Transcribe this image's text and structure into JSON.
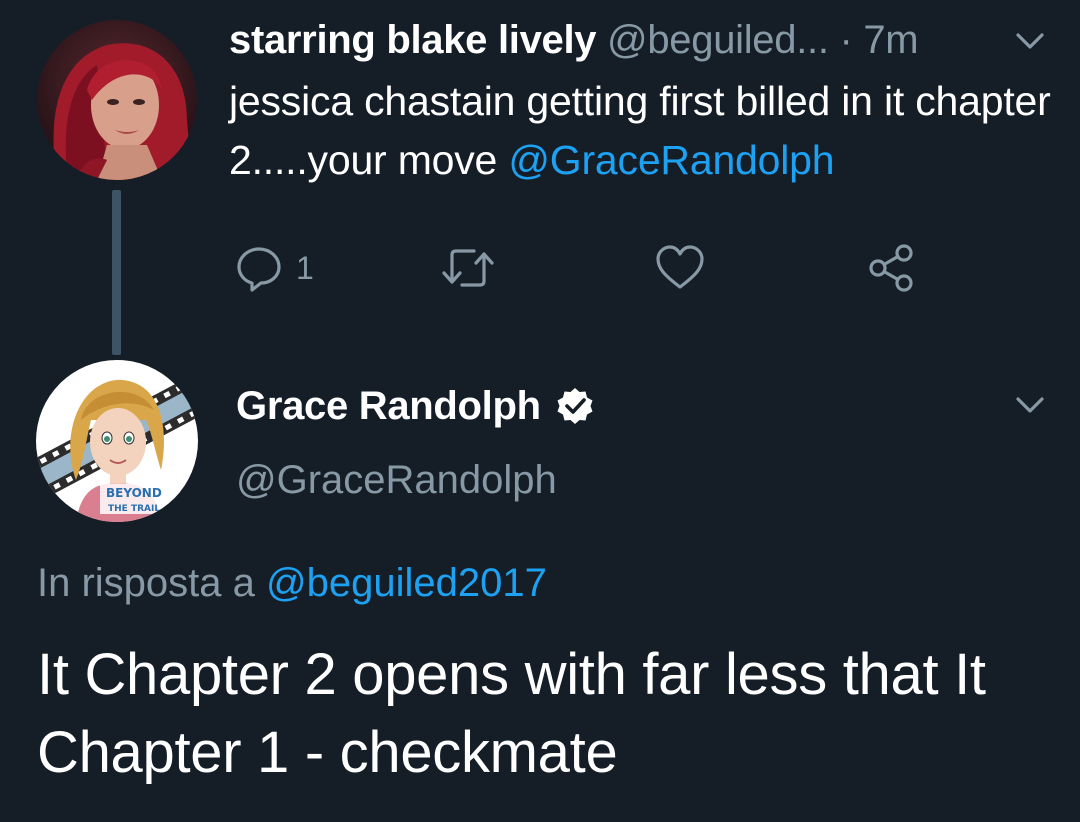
{
  "tweet1": {
    "display_name": "starring blake lively",
    "handle": "@beguiled...",
    "separator": "·",
    "time": "7m",
    "text_before": "jessica chastain getting first billed in it chapter 2.....your move ",
    "mention": "@GraceRandolph",
    "reply_count": "1",
    "avatar_icon": "user-photo",
    "menu_icon": "chevron-down-icon"
  },
  "actions": {
    "reply_icon": "reply-icon",
    "retweet_icon": "retweet-icon",
    "like_icon": "heart-icon",
    "share_icon": "share-icon"
  },
  "tweet2": {
    "display_name": "Grace Randolph",
    "handle": "@GraceRandolph",
    "verified_icon": "verified-badge-icon",
    "reply_prefix": "In risposta a ",
    "reply_to": "@beguiled2017",
    "text": "It Chapter 2 opens with far less that It Chapter 1 - checkmate",
    "avatar_text_line1": "BEYOND",
    "avatar_text_line2": "THE TRAIL"
  },
  "colors": {
    "background": "#151d27",
    "accent": "#1da1f2",
    "secondary_text": "#8899a6",
    "thread_line": "#3d5466"
  }
}
